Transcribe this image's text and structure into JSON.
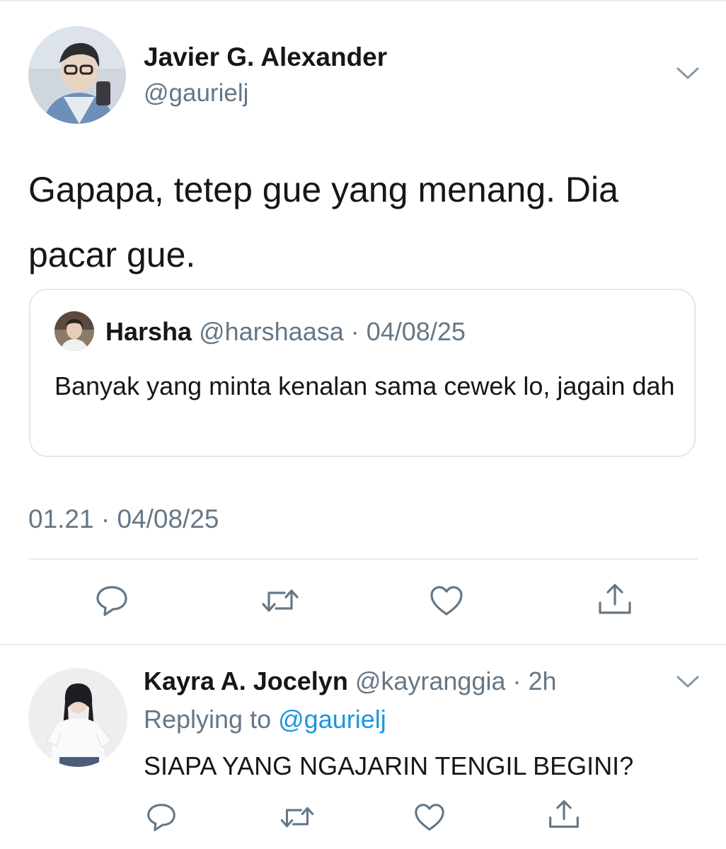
{
  "main_tweet": {
    "author_name": "Javier G. Alexander",
    "author_handle": "@gaurielj",
    "text": "Gapapa, tetep gue yang menang. Dia pacar gue.",
    "timestamp": "01.21 · 04/08/25",
    "avatar_icon": "profile-photo",
    "menu_icon": "chevron-down-icon",
    "quoted_tweet": {
      "author_name": "Harsha",
      "meta": "@harshaasa · 04/08/25",
      "text": "Banyak yang minta kenalan sama cewek lo, jagain dah",
      "avatar_icon": "profile-photo"
    },
    "actions": [
      "reply-icon",
      "retweet-icon",
      "like-icon",
      "share-icon"
    ]
  },
  "reply": {
    "author_name": "Kayra A. Jocelyn",
    "meta": "@kayranggia · 2h",
    "replying_prefix": "Replying to",
    "replying_mention": "@gaurielj",
    "text": "SIAPA YANG NGAJARIN TENGIL BEGINI?",
    "avatar_icon": "profile-photo",
    "menu_icon": "chevron-down-icon",
    "actions": [
      "reply-icon",
      "retweet-icon",
      "like-icon",
      "share-icon"
    ]
  },
  "colors": {
    "text_primary": "#14171a",
    "text_secondary": "#657786",
    "link": "#1b95e0",
    "border": "#e1e8ed",
    "icon": "#657786"
  }
}
